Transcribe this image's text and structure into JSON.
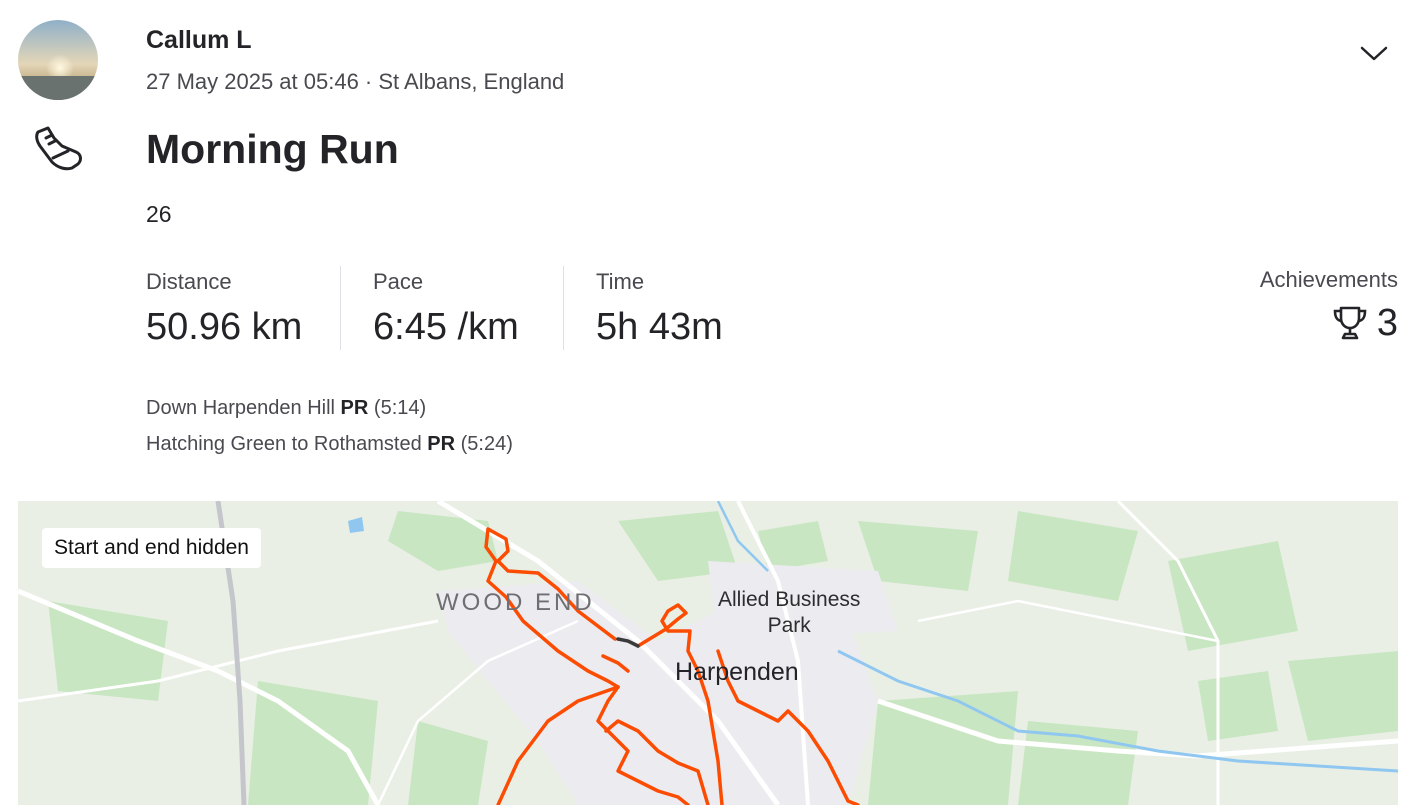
{
  "athlete": {
    "name": "Callum L",
    "date_location": "27 May 2025 at 05:46 · St Albans, England"
  },
  "activity": {
    "sport_icon": "running-shoe-icon",
    "title": "Morning Run",
    "description": "26"
  },
  "stats": [
    {
      "label": "Distance",
      "value": "50.96 km"
    },
    {
      "label": "Pace",
      "value": "6:45 /km"
    },
    {
      "label": "Time",
      "value": "5h 43m"
    }
  ],
  "achievements": {
    "label": "Achievements",
    "icon": "trophy-icon",
    "count": "3"
  },
  "segments": [
    {
      "name": "Down Harpenden Hill",
      "badge": "PR",
      "time": "(5:14)"
    },
    {
      "name": "Hatching Green to Rothamsted",
      "badge": "PR",
      "time": "(5:24)"
    }
  ],
  "map": {
    "privacy_badge": "Start and end hidden",
    "labels": {
      "wood_end": "WOOD END",
      "business_line1": "Allied Business",
      "business_line2": "Park",
      "town": "Harpenden"
    },
    "route_color": "#fc4c02",
    "hidden_route_color": "#3a3a3a"
  },
  "colors": {
    "text_primary": "#242428",
    "text_secondary": "#494950",
    "map_background": "#e9efe5",
    "water": "#8fc7f0"
  }
}
